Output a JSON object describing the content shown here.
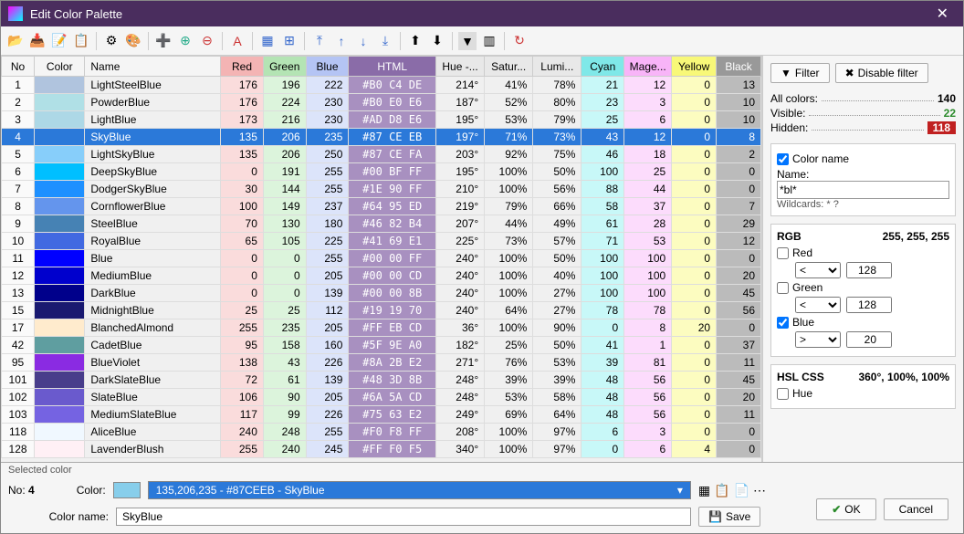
{
  "window": {
    "title": "Edit Color Palette"
  },
  "headers": {
    "no": "No",
    "color": "Color",
    "name": "Name",
    "red": "Red",
    "green": "Green",
    "blue": "Blue",
    "html": "HTML",
    "hue": "Hue -...",
    "sat": "Satur...",
    "lum": "Lumi...",
    "cyan": "Cyan",
    "mag": "Mage...",
    "yel": "Yellow",
    "blk": "Black"
  },
  "rows": [
    {
      "no": 1,
      "hex": "#B0C4DE",
      "name": "LightSteelBlue",
      "r": 176,
      "g": 196,
      "b": 222,
      "html": "#B0 C4 DE",
      "hue": "214°",
      "sat": "41%",
      "lum": "78%",
      "c": 21,
      "m": 12,
      "y": 0,
      "k": 13
    },
    {
      "no": 2,
      "hex": "#B0E0E6",
      "name": "PowderBlue",
      "r": 176,
      "g": 224,
      "b": 230,
      "html": "#B0 E0 E6",
      "hue": "187°",
      "sat": "52%",
      "lum": "80%",
      "c": 23,
      "m": 3,
      "y": 0,
      "k": 10
    },
    {
      "no": 3,
      "hex": "#ADD8E6",
      "name": "LightBlue",
      "r": 173,
      "g": 216,
      "b": 230,
      "html": "#AD D8 E6",
      "hue": "195°",
      "sat": "53%",
      "lum": "79%",
      "c": 25,
      "m": 6,
      "y": 0,
      "k": 10
    },
    {
      "no": 4,
      "hex": "#87CEEB",
      "name": "SkyBlue",
      "r": 135,
      "g": 206,
      "b": 235,
      "html": "#87 CE EB",
      "hue": "197°",
      "sat": "71%",
      "lum": "73%",
      "c": 43,
      "m": 12,
      "y": 0,
      "k": 8,
      "sel": true
    },
    {
      "no": 5,
      "hex": "#87CEFA",
      "name": "LightSkyBlue",
      "r": 135,
      "g": 206,
      "b": 250,
      "html": "#87 CE FA",
      "hue": "203°",
      "sat": "92%",
      "lum": "75%",
      "c": 46,
      "m": 18,
      "y": 0,
      "k": 2
    },
    {
      "no": 6,
      "hex": "#00BFFF",
      "name": "DeepSkyBlue",
      "r": 0,
      "g": 191,
      "b": 255,
      "html": "#00 BF FF",
      "hue": "195°",
      "sat": "100%",
      "lum": "50%",
      "c": 100,
      "m": 25,
      "y": 0,
      "k": 0
    },
    {
      "no": 7,
      "hex": "#1E90FF",
      "name": "DodgerSkyBlue",
      "r": 30,
      "g": 144,
      "b": 255,
      "html": "#1E 90 FF",
      "hue": "210°",
      "sat": "100%",
      "lum": "56%",
      "c": 88,
      "m": 44,
      "y": 0,
      "k": 0
    },
    {
      "no": 8,
      "hex": "#6495ED",
      "name": "CornflowerBlue",
      "r": 100,
      "g": 149,
      "b": 237,
      "html": "#64 95 ED",
      "hue": "219°",
      "sat": "79%",
      "lum": "66%",
      "c": 58,
      "m": 37,
      "y": 0,
      "k": 7
    },
    {
      "no": 9,
      "hex": "#4682B4",
      "name": "SteelBlue",
      "r": 70,
      "g": 130,
      "b": 180,
      "html": "#46 82 B4",
      "hue": "207°",
      "sat": "44%",
      "lum": "49%",
      "c": 61,
      "m": 28,
      "y": 0,
      "k": 29
    },
    {
      "no": 10,
      "hex": "#4169E1",
      "name": "RoyalBlue",
      "r": 65,
      "g": 105,
      "b": 225,
      "html": "#41 69 E1",
      "hue": "225°",
      "sat": "73%",
      "lum": "57%",
      "c": 71,
      "m": 53,
      "y": 0,
      "k": 12
    },
    {
      "no": 11,
      "hex": "#0000FF",
      "name": "Blue",
      "r": 0,
      "g": 0,
      "b": 255,
      "html": "#00 00 FF",
      "hue": "240°",
      "sat": "100%",
      "lum": "50%",
      "c": 100,
      "m": 100,
      "y": 0,
      "k": 0
    },
    {
      "no": 12,
      "hex": "#0000CD",
      "name": "MediumBlue",
      "r": 0,
      "g": 0,
      "b": 205,
      "html": "#00 00 CD",
      "hue": "240°",
      "sat": "100%",
      "lum": "40%",
      "c": 100,
      "m": 100,
      "y": 0,
      "k": 20
    },
    {
      "no": 13,
      "hex": "#00008B",
      "name": "DarkBlue",
      "r": 0,
      "g": 0,
      "b": 139,
      "html": "#00 00 8B",
      "hue": "240°",
      "sat": "100%",
      "lum": "27%",
      "c": 100,
      "m": 100,
      "y": 0,
      "k": 45
    },
    {
      "no": 15,
      "hex": "#191970",
      "name": "MidnightBlue",
      "r": 25,
      "g": 25,
      "b": 112,
      "html": "#19 19 70",
      "hue": "240°",
      "sat": "64%",
      "lum": "27%",
      "c": 78,
      "m": 78,
      "y": 0,
      "k": 56
    },
    {
      "no": 17,
      "hex": "#FFEBCD",
      "name": "BlanchedAlmond",
      "r": 255,
      "g": 235,
      "b": 205,
      "html": "#FF EB CD",
      "hue": "36°",
      "sat": "100%",
      "lum": "90%",
      "c": 0,
      "m": 8,
      "y": 20,
      "k": 0
    },
    {
      "no": 42,
      "hex": "#5F9EA0",
      "name": "CadetBlue",
      "r": 95,
      "g": 158,
      "b": 160,
      "html": "#5F 9E A0",
      "hue": "182°",
      "sat": "25%",
      "lum": "50%",
      "c": 41,
      "m": 1,
      "y": 0,
      "k": 37
    },
    {
      "no": 95,
      "hex": "#8A2BE2",
      "name": "BlueViolet",
      "r": 138,
      "g": 43,
      "b": 226,
      "html": "#8A 2B E2",
      "hue": "271°",
      "sat": "76%",
      "lum": "53%",
      "c": 39,
      "m": 81,
      "y": 0,
      "k": 11
    },
    {
      "no": 101,
      "hex": "#483D8B",
      "name": "DarkSlateBlue",
      "r": 72,
      "g": 61,
      "b": 139,
      "html": "#48 3D 8B",
      "hue": "248°",
      "sat": "39%",
      "lum": "39%",
      "c": 48,
      "m": 56,
      "y": 0,
      "k": 45
    },
    {
      "no": 102,
      "hex": "#6A5ACD",
      "name": "SlateBlue",
      "r": 106,
      "g": 90,
      "b": 205,
      "html": "#6A 5A CD",
      "hue": "248°",
      "sat": "53%",
      "lum": "58%",
      "c": 48,
      "m": 56,
      "y": 0,
      "k": 20
    },
    {
      "no": 103,
      "hex": "#7563E2",
      "name": "MediumSlateBlue",
      "r": 117,
      "g": 99,
      "b": 226,
      "html": "#75 63 E2",
      "hue": "249°",
      "sat": "69%",
      "lum": "64%",
      "c": 48,
      "m": 56,
      "y": 0,
      "k": 11
    },
    {
      "no": 118,
      "hex": "#F0F8FF",
      "name": "AliceBlue",
      "r": 240,
      "g": 248,
      "b": 255,
      "html": "#F0 F8 FF",
      "hue": "208°",
      "sat": "100%",
      "lum": "97%",
      "c": 6,
      "m": 3,
      "y": 0,
      "k": 0
    },
    {
      "no": 128,
      "hex": "#FFF0F5",
      "name": "LavenderBlush",
      "r": 255,
      "g": 240,
      "b": 245,
      "html": "#FF F0 F5",
      "hue": "340°",
      "sat": "100%",
      "lum": "97%",
      "c": 0,
      "m": 6,
      "y": 4,
      "k": 0
    }
  ],
  "filter": {
    "btnFilter": "Filter",
    "btnDisable": "Disable filter",
    "lblAll": "All colors:",
    "valAll": "140",
    "lblVis": "Visible:",
    "valVis": "22",
    "lblHid": "Hidden:",
    "valHid": "118",
    "chkColorName": "Color name",
    "lblName": "Name:",
    "nameVal": "*bl*",
    "wildcards": "Wildcards: * ?",
    "rgbHdr": "RGB",
    "rgbVal": "255, 255, 255",
    "chkRed": "Red",
    "chkGreen": "Green",
    "chkBlue": "Blue",
    "opLt": "<",
    "opGt": ">",
    "v128": "128",
    "v20": "20",
    "hslHdr": "HSL CSS",
    "hslVal": "360°, 100%, 100%",
    "chkHue": "Hue"
  },
  "selected": {
    "hdr": "Selected color",
    "noLbl": "No:",
    "noVal": "4",
    "colorLbl": "Color:",
    "comboText": "135,206,235 - #87CEEB - SkyBlue",
    "nameLbl": "Color name:",
    "nameVal": "SkyBlue",
    "save": "Save",
    "ok": "OK",
    "cancel": "Cancel"
  }
}
